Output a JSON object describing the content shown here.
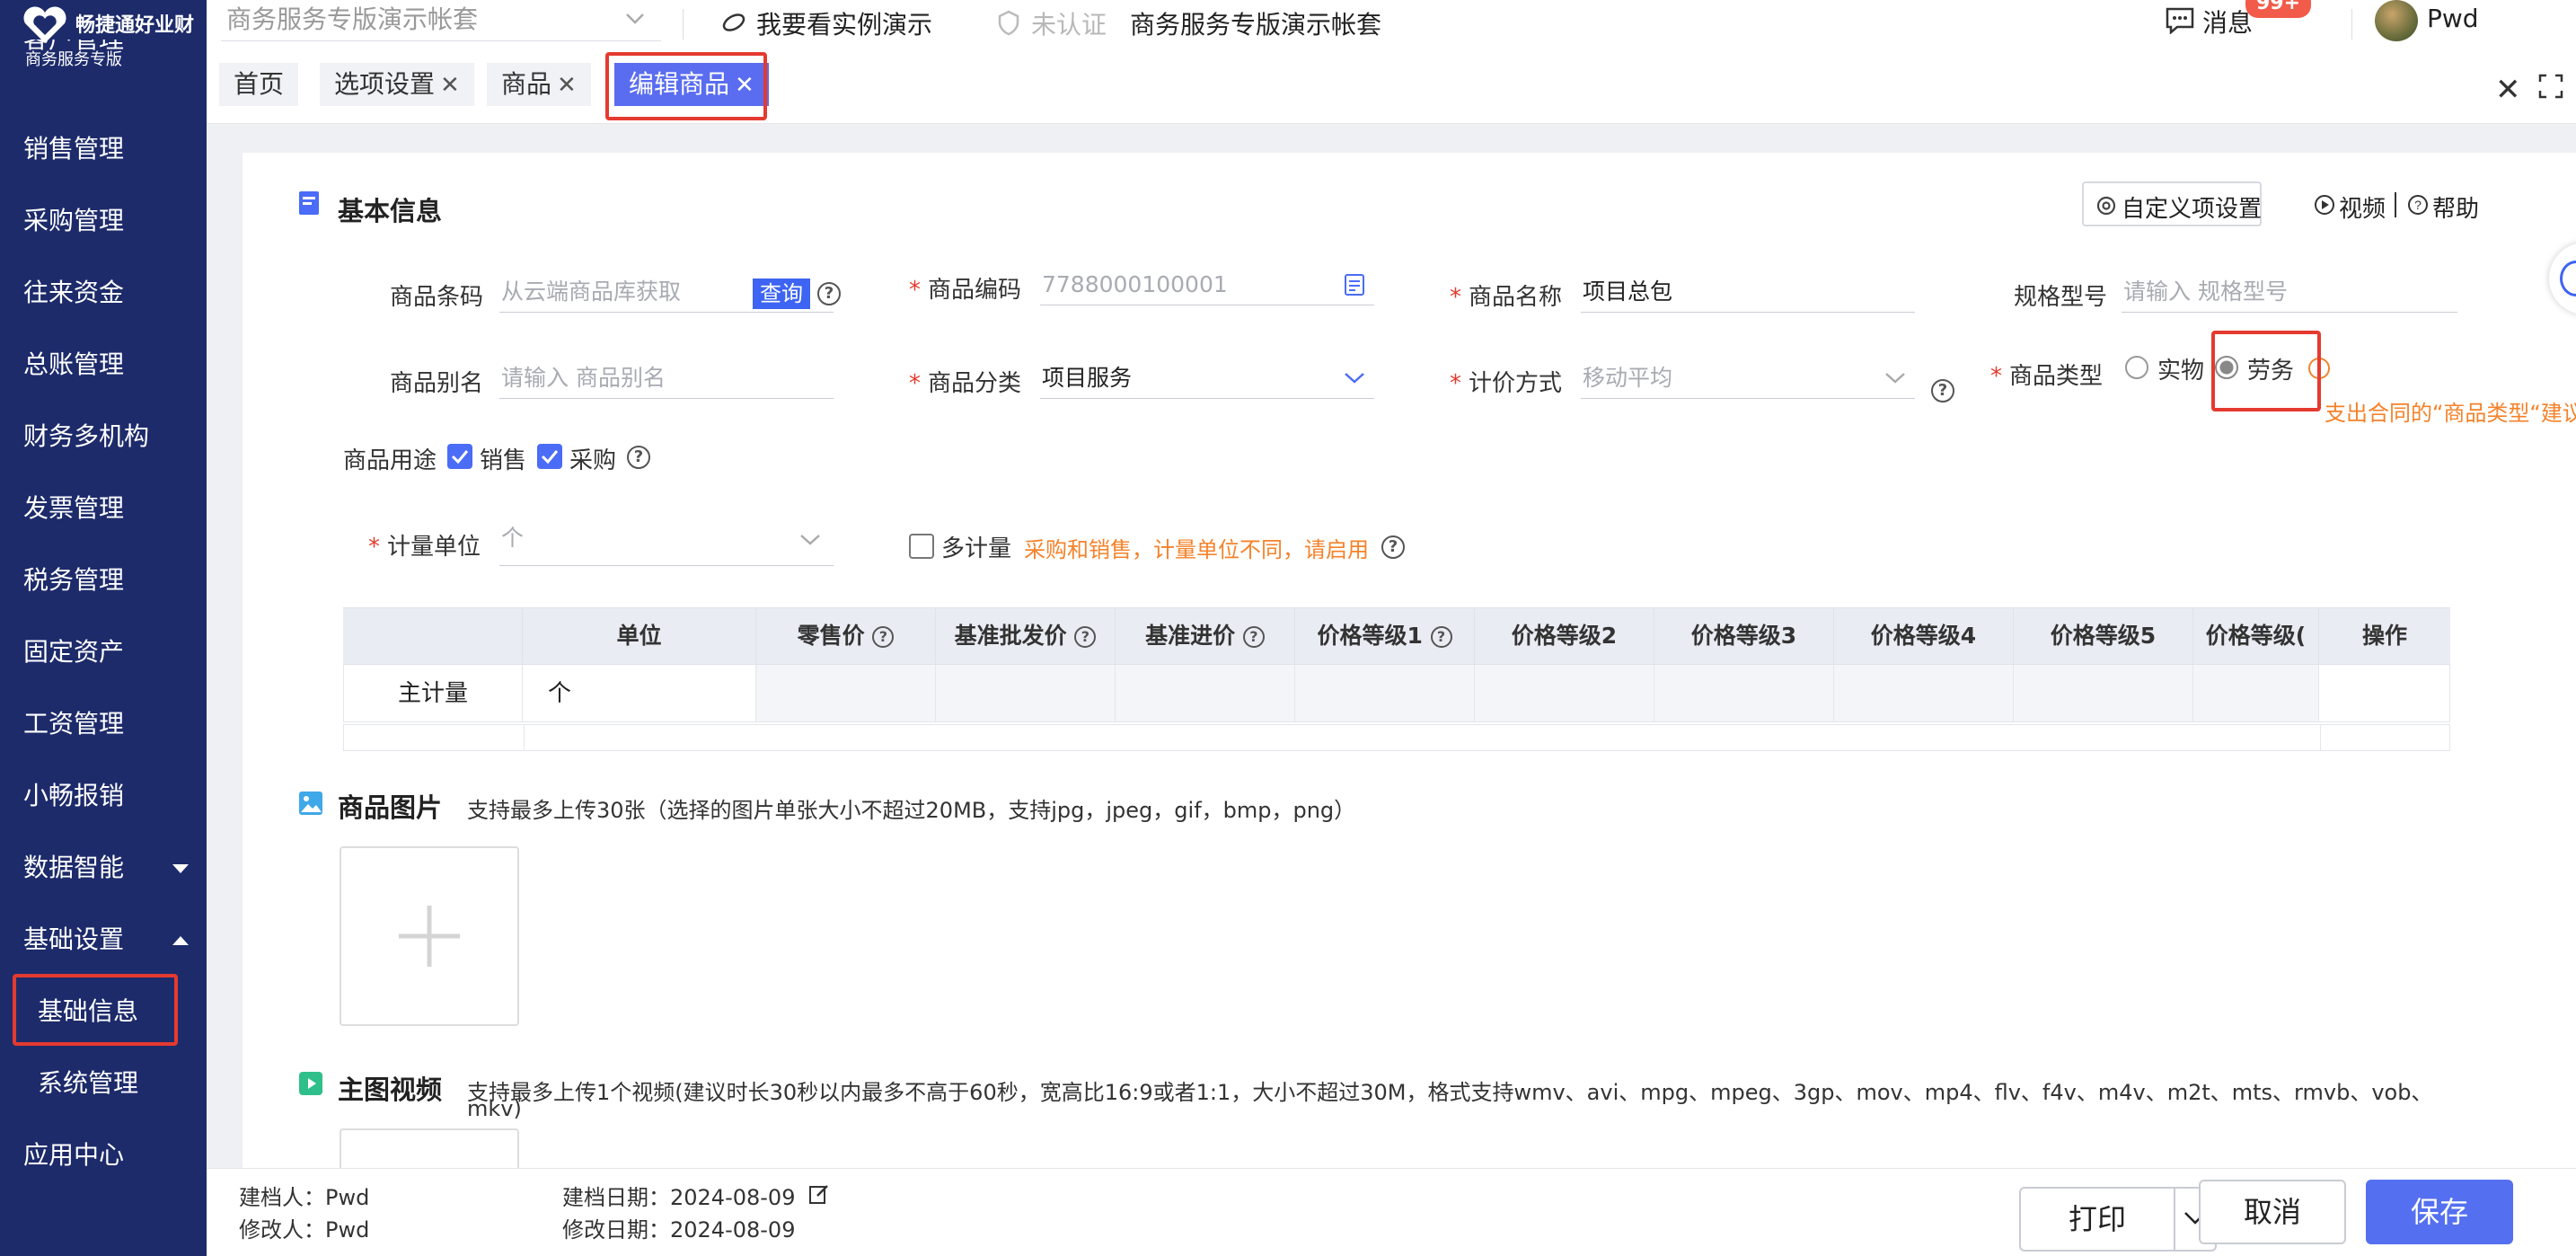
{
  "brand": {
    "name": "畅捷通好业财",
    "edition": "商务服务专版"
  },
  "topbar": {
    "account_select": "商务服务专版演示帐套",
    "demo_link": "我要看实例演示",
    "unverified": "未认证",
    "account_name": "商务服务专版演示帐套",
    "messages_label": "消息",
    "messages_badge": "99+",
    "user": "Pwd"
  },
  "sidebar": {
    "items": [
      {
        "label": "客户管理"
      },
      {
        "label": "销售管理"
      },
      {
        "label": "采购管理"
      },
      {
        "label": "往来资金"
      },
      {
        "label": "总账管理"
      },
      {
        "label": "财务多机构"
      },
      {
        "label": "发票管理"
      },
      {
        "label": "税务管理"
      },
      {
        "label": "固定资产"
      },
      {
        "label": "工资管理"
      },
      {
        "label": "小畅报销"
      },
      {
        "label": "数据智能"
      },
      {
        "label": "基础设置"
      },
      {
        "label": "基础信息"
      },
      {
        "label": "系统管理"
      },
      {
        "label": "应用中心"
      }
    ]
  },
  "tabs": [
    {
      "label": "首页"
    },
    {
      "label": "选项设置"
    },
    {
      "label": "商品"
    },
    {
      "label": "编辑商品"
    }
  ],
  "basic": {
    "title": "基本信息",
    "custom_settings": "自定义项设置",
    "video": "视频",
    "help": "帮助",
    "barcode_label": "商品条码",
    "barcode_placeholder": "从云端商品库获取",
    "query_btn": "查询",
    "code_label": "商品编码",
    "code_placeholder": "7788000100001",
    "name_label": "商品名称",
    "name_value": "项目总包",
    "spec_label": "规格型号",
    "spec_placeholder": "请输入 规格型号",
    "alias_label": "商品别名",
    "alias_placeholder": "请输入 商品别名",
    "category_label": "商品分类",
    "category_value": "项目服务",
    "pricing_label": "计价方式",
    "pricing_value": "移动平均",
    "type_label": "商品类型",
    "type_physical": "实物",
    "type_service": "劳务",
    "type_note": "支出合同的“商品类型“建议",
    "usage_label": "商品用途",
    "usage_sales": "销售",
    "usage_purchase": "采购",
    "unit_label": "计量单位",
    "unit_value": "个",
    "multi_unit_label": "多计量",
    "multi_unit_hint": "采购和销售，计量单位不同，请启用"
  },
  "table": {
    "headers": [
      "",
      "单位",
      "零售价",
      "基准批发价",
      "基准进价",
      "价格等级1",
      "价格等级2",
      "价格等级3",
      "价格等级4",
      "价格等级5",
      "价格等级(",
      "操作"
    ],
    "row_label": "主计量",
    "row_unit": "个"
  },
  "images": {
    "title": "商品图片",
    "hint": "支持最多上传30张（选择的图片单张大小不超过20MB，支持jpg，jpeg，gif，bmp，png）"
  },
  "video": {
    "title": "主图视频",
    "hint_line1": "支持最多上传1个视频(建议时长30秒以内最多不高于60秒，宽高比16:9或者1:1，大小不超过30M，格式支持wmv、avi、mpg、mpeg、3gp、mov、mp4、flv、f4v、m4v、m2t、mts、rmvb、vob、",
    "hint_line2": "mkv)"
  },
  "footer": {
    "creator": "建档人：Pwd",
    "modifier": "修改人：Pwd",
    "created": "建档日期：2024-08-09",
    "modified": "修改日期：2024-08-09",
    "print": "打印",
    "cancel": "取消",
    "save": "保存"
  },
  "colors": {
    "sidebar": "#1d2b6b",
    "primary": "#5470f0",
    "highlight": "#e53a2f",
    "hint": "#f5822a"
  }
}
